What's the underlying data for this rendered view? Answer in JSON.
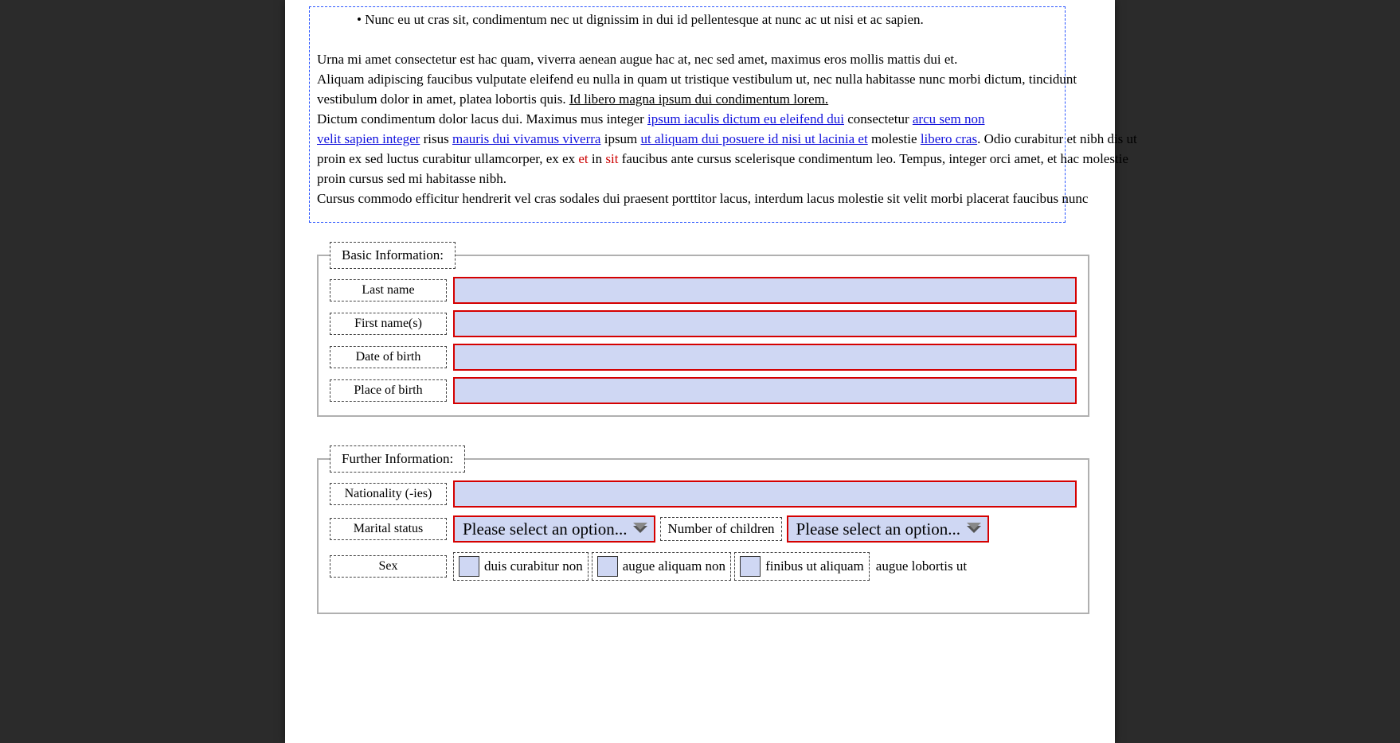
{
  "instructions": {
    "bullet_line": "•   Nunc eu ut cras sit, condimentum nec ut dignissim in dui id pellentesque at nunc ac ut nisi et ac sapien.",
    "p2": "Urna mi amet consectetur est hac quam, viverra aenean augue hac at, nec sed amet, maximus eros mollis mattis dui et.",
    "p3": "Aliquam adipiscing faucibus vulputate eleifend eu nulla in quam ut tristique vestibulum ut, nec nulla habitasse nunc morbi dictum, tincidunt",
    "p4a": "vestibulum dolor in amet, platea lobortis quis. ",
    "p4u": "Id libero magna ipsum dui condimentum lorem.",
    "p5a": "Dictum condimentum dolor lacus dui. Maximus mus integer ",
    "p5blue": "ipsum iaculis dictum eu eleifend dui",
    "p5b": " consectetur ",
    "p5bblue": "arcu sem non",
    "p6a_blue": "velit sapien integer",
    "p6b": " risus ",
    "p6b_blue": "mauris dui vivamus viverra",
    "p6c": " ipsum ",
    "p6c_blue": "ut aliquam dui posuere id nisi ut lacinia et",
    "p6d": " molestie ",
    "p6d_blue": "libero cras",
    "p6e": ". Odio curabitur et nibh dis ut",
    "p7a": "proin ex sed luctus curabitur ullamcorper, ex ex ",
    "p7red": "et",
    "p7b": " in ",
    "p7red2": "sit",
    "p7c": " faucibus ante cursus scelerisque condimentum leo. Tempus, integer orci amet, et hac molestie",
    "p8": "proin cursus sed mi habitasse nibh.",
    "p9": "Cursus commodo efficitur hendrerit vel cras sodales dui praesent porttitor lacus, interdum lacus molestie sit velit morbi placerat faucibus nunc"
  },
  "section1": {
    "legend": "Basic Information:",
    "labels": {
      "last": "Last name",
      "first": "First name(s)",
      "dob": "Date of birth",
      "place": "Place of birth"
    }
  },
  "section2": {
    "legend": "Further Information:",
    "labels": {
      "nationality": "Nationality (-ies)",
      "marital": "Marital status",
      "children": "Number of children",
      "sex": "Sex",
      "checkbox_a": "duis curabitur non",
      "checkbox_b": "augue aliquam non",
      "checkbox_c": "finibus ut aliquam",
      "extra": "augue lobortis ut"
    },
    "dropdown": "Please select an option..."
  }
}
